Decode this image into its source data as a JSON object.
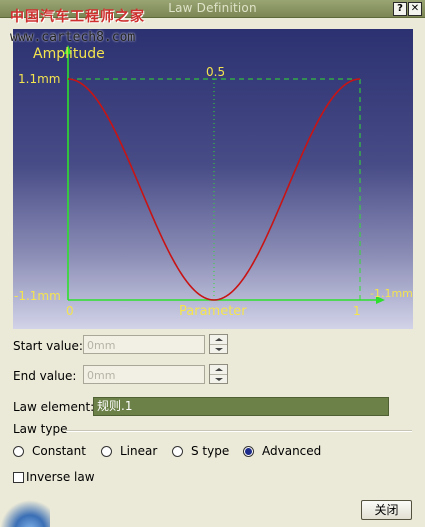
{
  "window": {
    "title": "Law Definition",
    "help_glyph": "?",
    "close_glyph": "✕"
  },
  "watermark": {
    "chinese": "中国汽车工程师之家",
    "url": "www.cartech8.com"
  },
  "plot": {
    "ylabel": "Amplitude",
    "xlabel": "Parameter",
    "y_max_label": "1.1mm",
    "y_min_label": "-1.1mm",
    "x_min_label": "0",
    "x_max_label": "1",
    "x_mid_label": "0.5",
    "right_label": "-1.1mm",
    "colors": {
      "axis": "#2ee02e",
      "curve": "#c81414",
      "background": "#2c3171"
    }
  },
  "form": {
    "start_label": "Start value:",
    "start_value": "0mm",
    "end_label": "End value:",
    "end_value": "0mm",
    "law_element_label": "Law element:",
    "law_element_value": "规则.1",
    "law_type_title": "Law type",
    "radios": [
      {
        "label": "Constant",
        "checked": false
      },
      {
        "label": "Linear",
        "checked": false
      },
      {
        "label": "S type",
        "checked": false
      },
      {
        "label": "Advanced",
        "checked": true
      }
    ],
    "inverse_label": "Inverse law",
    "inverse_checked": false,
    "close_label": "关闭"
  }
}
